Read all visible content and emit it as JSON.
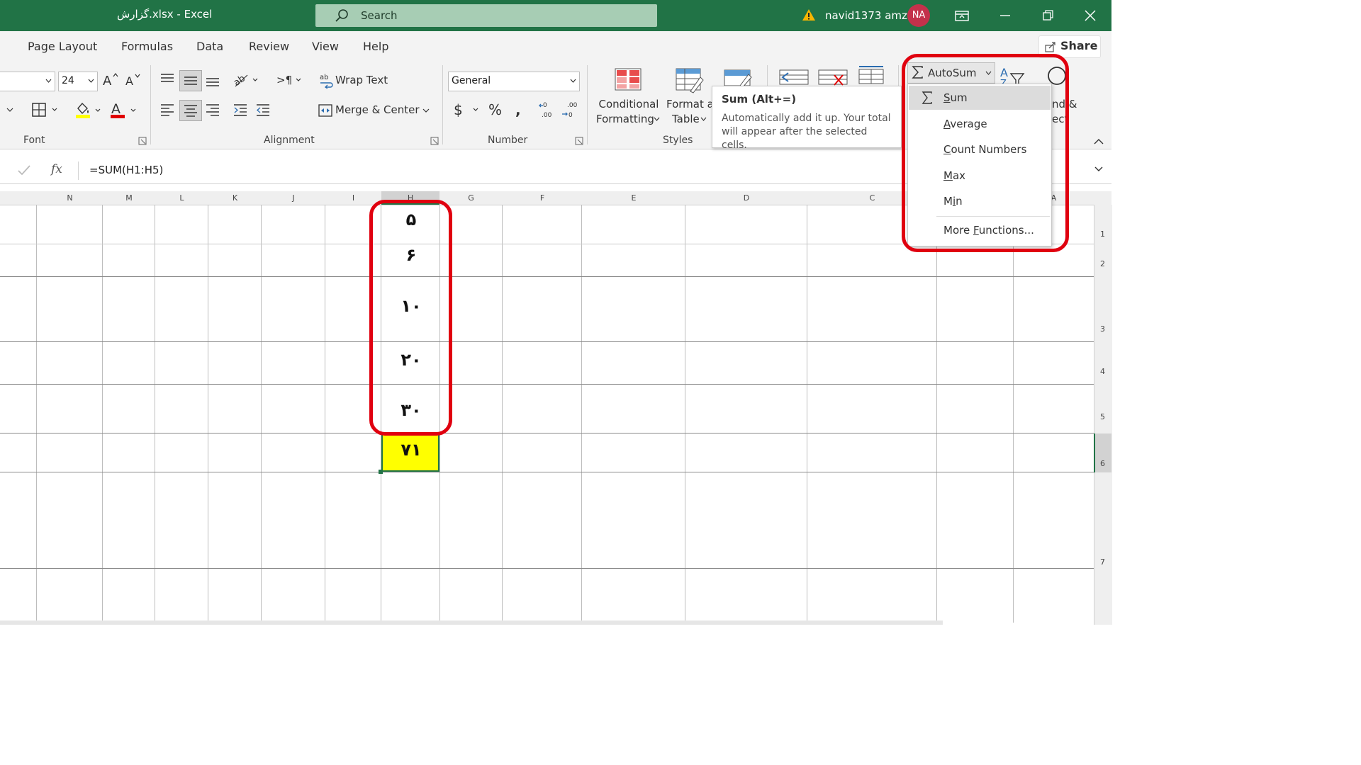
{
  "titlebar": {
    "title": "گزارش.xlsx  -  Excel",
    "search_placeholder": "Search",
    "user": "navid1373 amz",
    "avatar": "NA"
  },
  "tabs": [
    {
      "label": "Page Layout"
    },
    {
      "label": "Formulas"
    },
    {
      "label": "Data"
    },
    {
      "label": "Review"
    },
    {
      "label": "View"
    },
    {
      "label": "Help"
    }
  ],
  "share_label": "Share",
  "ribbon": {
    "font_size": "24",
    "font_group": "Font",
    "alignment_group": "Alignment",
    "wrap_text": "Wrap Text",
    "merge_center": "Merge & Center",
    "number_format": "General",
    "number_group": "Number",
    "conditional_formatting_1": "Conditional",
    "conditional_formatting_2": "Formatting",
    "format_table_1": "Format a",
    "format_table_2": "Table",
    "styles_group": "Styles",
    "autosum": "AutoSum",
    "find_select_1": "nd &",
    "find_select_2": "ect"
  },
  "formula_bar": {
    "fx": "fx",
    "formula": "=SUM(H1:H5)"
  },
  "columns": [
    "N",
    "M",
    "L",
    "K",
    "J",
    "I",
    "H",
    "G",
    "F",
    "E",
    "D",
    "C",
    "A"
  ],
  "rows": [
    "1",
    "2",
    "3",
    "4",
    "5",
    "6",
    "7"
  ],
  "cells_h": [
    "۵",
    "۶",
    "۱۰",
    "۲۰",
    "۳۰"
  ],
  "result_cell": "۷۱",
  "tooltip": {
    "title": "Sum (Alt+=)",
    "body": "Automatically add it up. Your total will appear after the selected cells."
  },
  "autosum_menu": [
    {
      "pre": "",
      "u": "S",
      "post": "um"
    },
    {
      "pre": "",
      "u": "A",
      "post": "verage"
    },
    {
      "pre": "",
      "u": "C",
      "post": "ount Numbers"
    },
    {
      "pre": "",
      "u": "M",
      "post": "ax"
    },
    {
      "pre": "M",
      "u": "i",
      "post": "n"
    },
    {
      "pre": "More ",
      "u": "F",
      "post": "unctions..."
    }
  ],
  "colors": {
    "excel_green": "#217346",
    "highlight_red": "#e0000f",
    "result_fill": "#ffff00"
  }
}
